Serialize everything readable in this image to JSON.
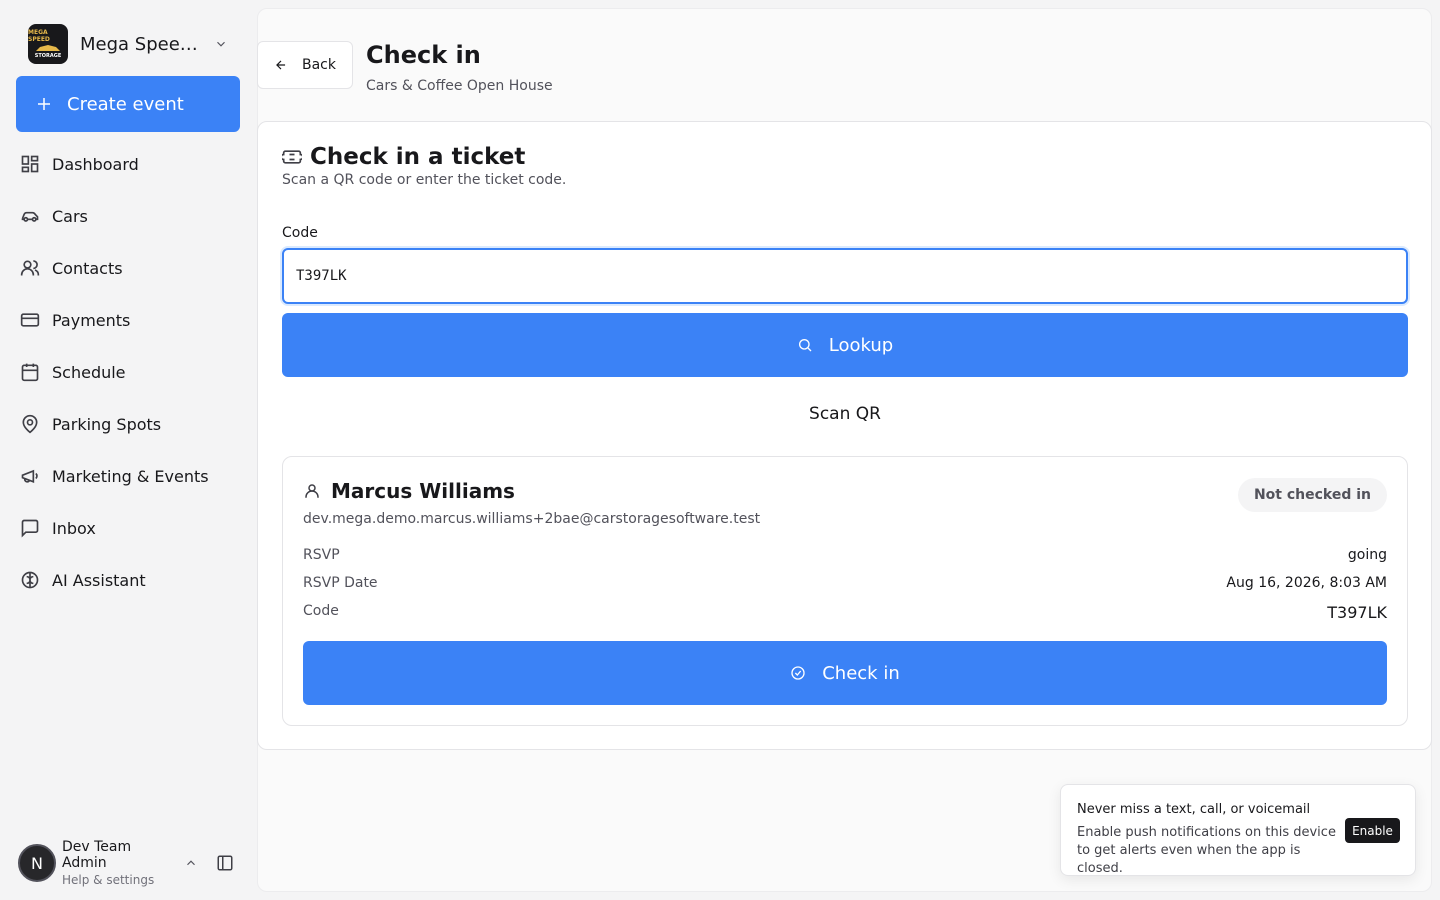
{
  "sidebar": {
    "org_name": "Mega Speed Storage",
    "logo_text_top": "MEGA SPEED",
    "logo_text_bottom": "STORAGE",
    "create_label": "Create event",
    "items": [
      {
        "label": "Dashboard",
        "icon": "dashboard-icon"
      },
      {
        "label": "Cars",
        "icon": "car-icon"
      },
      {
        "label": "Contacts",
        "icon": "contacts-icon"
      },
      {
        "label": "Payments",
        "icon": "credit-card-icon"
      },
      {
        "label": "Schedule",
        "icon": "calendar-icon"
      },
      {
        "label": "Parking Spots",
        "icon": "map-pin-icon"
      },
      {
        "label": "Marketing & Events",
        "icon": "megaphone-icon"
      },
      {
        "label": "Inbox",
        "icon": "message-icon"
      },
      {
        "label": "AI Assistant",
        "icon": "brain-icon"
      }
    ],
    "user": {
      "initial": "N",
      "name": "Dev Team Admin",
      "subtitle": "Help & settings"
    }
  },
  "header": {
    "back_label": "Back",
    "title": "Check in",
    "subtitle": "Cars & Coffee Open House"
  },
  "checkin": {
    "title": "Check in a ticket",
    "description": "Scan a QR code or enter the ticket code.",
    "code_label": "Code",
    "code_value": "T397LK",
    "lookup_label": "Lookup",
    "scan_label": "Scan QR"
  },
  "ticket": {
    "name": "Marcus Williams",
    "status": "Not checked in",
    "email": "dev.mega.demo.marcus.williams+2bae@carstoragesoftware.test",
    "rows": [
      {
        "key": "RSVP",
        "value": "going"
      },
      {
        "key": "RSVP Date",
        "value": "Aug 16, 2026, 8:03 AM"
      },
      {
        "key": "Code",
        "value": "T397LK"
      }
    ],
    "checkin_label": "Check in"
  },
  "toast": {
    "title": "Never miss a text, call, or voicemail",
    "body": "Enable push notifications on this device to get alerts even when the app is closed.",
    "button": "Enable"
  },
  "colors": {
    "accent": "#3b82f6",
    "text": "#18181b",
    "muted": "#52525b"
  }
}
